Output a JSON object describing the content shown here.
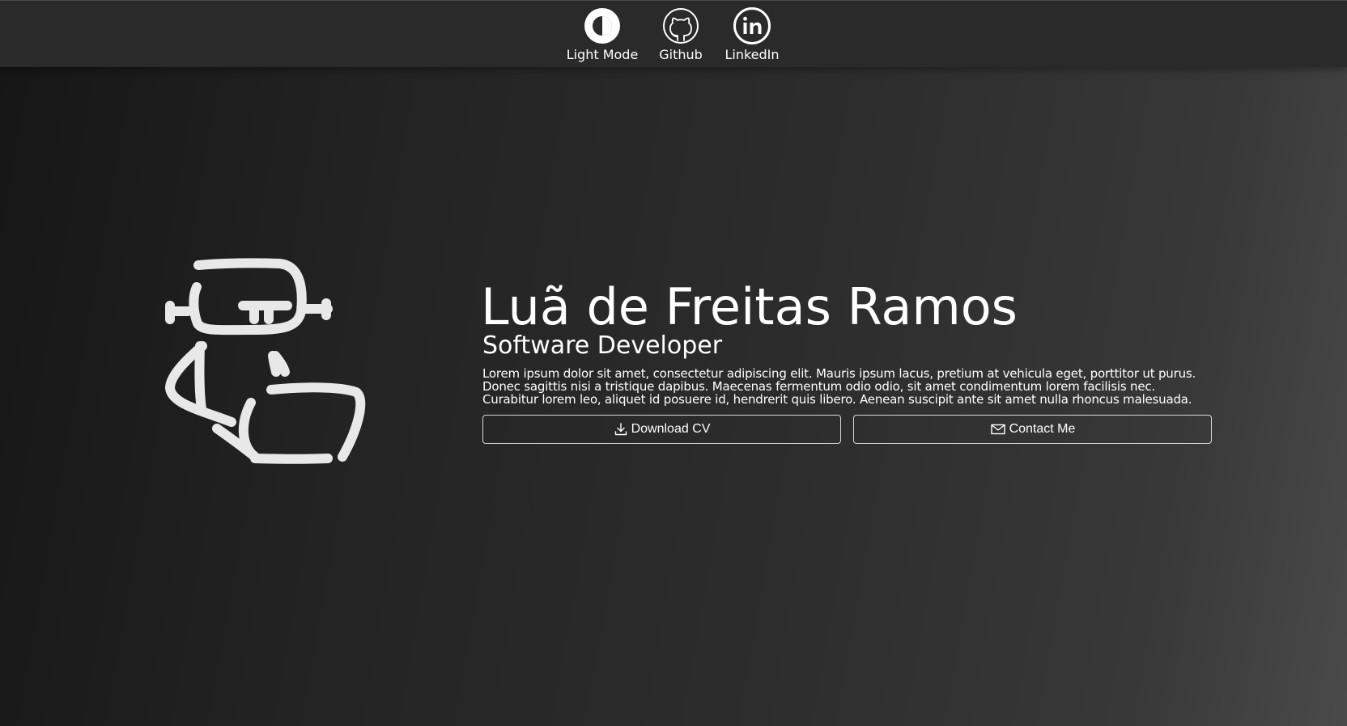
{
  "nav": {
    "items": [
      {
        "label": "Light Mode",
        "icon": "contrast-icon"
      },
      {
        "label": "Github",
        "icon": "github-icon"
      },
      {
        "label": "LinkedIn",
        "icon": "linkedin-icon"
      }
    ]
  },
  "hero": {
    "illustration": "robot-laptop-icon",
    "name": "Luã de Freitas Ramos",
    "role": "Software Developer",
    "description_lines": [
      "Lorem ipsum dolor sit amet, consectetur adipiscing elit. Mauris ipsum lacus, pretium at vehicula eget, porttitor ut purus.",
      "Donec sagittis nisi a tristique dapibus. Maecenas fermentum odio odio, sit amet condimentum lorem facilisis nec.",
      "Curabitur lorem leo, aliquet id posuere id, hendrerit quis libero. Aenean suscipit ante sit amet nulla rhoncus malesuada."
    ],
    "buttons": {
      "download_label": "Download CV",
      "download_icon": "download-icon",
      "contact_label": "Contact Me",
      "contact_icon": "mail-icon"
    }
  },
  "colors": {
    "text": "#ffffff",
    "topbar": "#2a2a2a",
    "background_start": "#161616",
    "background_end": "#4a4a4a",
    "button_border": "#d8d8d8"
  }
}
